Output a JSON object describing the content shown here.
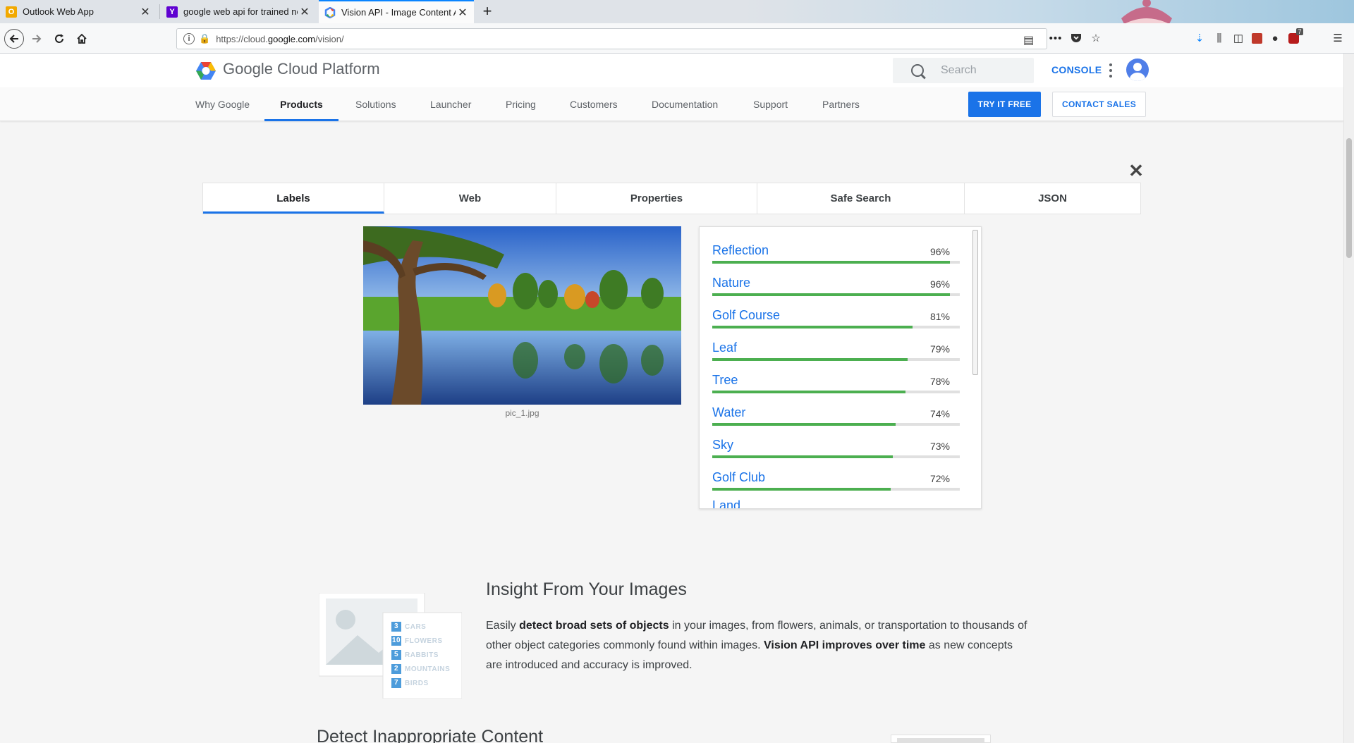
{
  "browser": {
    "tabs": [
      {
        "title": "Outlook Web App",
        "active": false
      },
      {
        "title": "google web api for trained ne",
        "active": false
      },
      {
        "title": "Vision API - Image Content An",
        "active": true
      }
    ],
    "url_prefix": "https://cloud.",
    "url_domain": "google.com",
    "url_path": "/vision/",
    "download_badge": "7"
  },
  "header": {
    "brand": "Google Cloud Platform",
    "search_placeholder": "Search",
    "console": "CONSOLE"
  },
  "nav": {
    "items": [
      "Why Google",
      "Products",
      "Solutions",
      "Launcher",
      "Pricing",
      "Customers",
      "Documentation",
      "Support",
      "Partners"
    ],
    "active": "Products",
    "try_free": "TRY IT FREE",
    "contact_sales": "CONTACT SALES"
  },
  "results": {
    "tabs": [
      "Labels",
      "Web",
      "Properties",
      "Safe Search",
      "JSON"
    ],
    "active_tab": "Labels",
    "image_caption": "pic_1.jpg",
    "labels": [
      {
        "name": "Reflection",
        "score": 96,
        "score_text": "96%"
      },
      {
        "name": "Nature",
        "score": 96,
        "score_text": "96%"
      },
      {
        "name": "Golf Course",
        "score": 81,
        "score_text": "81%"
      },
      {
        "name": "Leaf",
        "score": 79,
        "score_text": "79%"
      },
      {
        "name": "Tree",
        "score": 78,
        "score_text": "78%"
      },
      {
        "name": "Water",
        "score": 74,
        "score_text": "74%"
      },
      {
        "name": "Sky",
        "score": 73,
        "score_text": "73%"
      },
      {
        "name": "Golf Club",
        "score": 72,
        "score_text": "72%"
      }
    ],
    "label_partial": "Land"
  },
  "insight": {
    "title": "Insight From Your Images",
    "p1": "Easily ",
    "b1": "detect broad sets of objects",
    "p2": " in your images, from flowers, animals, or transportation to thousands of other object categories commonly found within images. ",
    "b2": "Vision API improves over time",
    "p3": " as new concepts are introduced and accuracy is improved.",
    "illustration_rows": [
      {
        "count": "3",
        "label": "CARS"
      },
      {
        "count": "10",
        "label": "FLOWERS"
      },
      {
        "count": "5",
        "label": "RABBITS"
      },
      {
        "count": "2",
        "label": "MOUNTAINS"
      },
      {
        "count": "7",
        "label": "BIRDS"
      }
    ]
  },
  "detect": {
    "title": "Detect Inappropriate Content"
  },
  "colors": {
    "accent": "#1a73e8",
    "bar_fill": "#4caf50",
    "bar_track": "#e0e0e0"
  }
}
